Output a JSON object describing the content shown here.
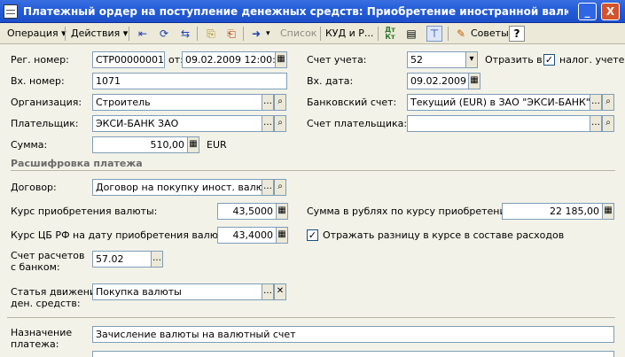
{
  "window": {
    "title": "Платежный ордер на поступление денежных средств: Приобретение иностранной валюты. Проведен *",
    "minimize": "_",
    "close": "X"
  },
  "toolbar": {
    "operation": "Операция ▾",
    "actions": "Действия ▾",
    "list": "Список",
    "kudir": "КУД и Р...",
    "dt_kt": "Дт Кт",
    "tips": "Советы",
    "help": "?"
  },
  "form": {
    "reg_number_label": "Рег. номер:",
    "reg_number": "СТР00000001",
    "from_label": "от:",
    "reg_date": "09.02.2009 12:00:00",
    "account_label": "Счет учета:",
    "account": "52",
    "reflect_label": "Отразить в:",
    "tax_accounting_label": "налог. учете",
    "in_number_label": "Вх. номер:",
    "in_number": "1071",
    "in_date_label": "Вх. дата:",
    "in_date": "09.02.2009",
    "organization_label": "Организация:",
    "organization": "Строитель",
    "bank_account_label": "Банковский счет:",
    "bank_account": "Текущий (EUR) в ЗАО \"ЭКСИ-БАНК\"",
    "payer_label": "Плательщик:",
    "payer": "ЭКСИ-БАНК ЗАО",
    "payer_account_label": "Счет плательщика:",
    "payer_account": "",
    "amount_label": "Сумма:",
    "amount": "510,00",
    "currency": "EUR"
  },
  "breakdown": {
    "section_title": "Расшифровка платежа",
    "contract_label": "Договор:",
    "contract": "Договор на покупку иност. валюты №",
    "purchase_rate_label": "Курс приобретения валюты:",
    "purchase_rate": "43,5000",
    "rub_amount_label": "Сумма в рублях по курсу приобретения:",
    "rub_amount": "22 185,00",
    "cb_rate_label": "Курс ЦБ РФ на дату приобретения валюты:",
    "cb_rate": "43,4000",
    "reflect_diff_label": "Отражать разницу в курсе в составе расходов",
    "settlement_label_1": "Счет расчетов",
    "settlement_label_2": "с банком:",
    "settlement_account": "57.02",
    "cashflow_label_1": "Статья движения",
    "cashflow_label_2": "ден. средств:",
    "cashflow": "Покупка валюты"
  },
  "purpose": {
    "label_1": "Назначение",
    "label_2": "платежа:",
    "value": "Зачисление валюты на валютный счет"
  },
  "colors": {
    "title_bar": "#245edb",
    "toolbar": "#ece9d8",
    "form_bg": "#f3f2e8",
    "field_border": "#7f9db9"
  }
}
